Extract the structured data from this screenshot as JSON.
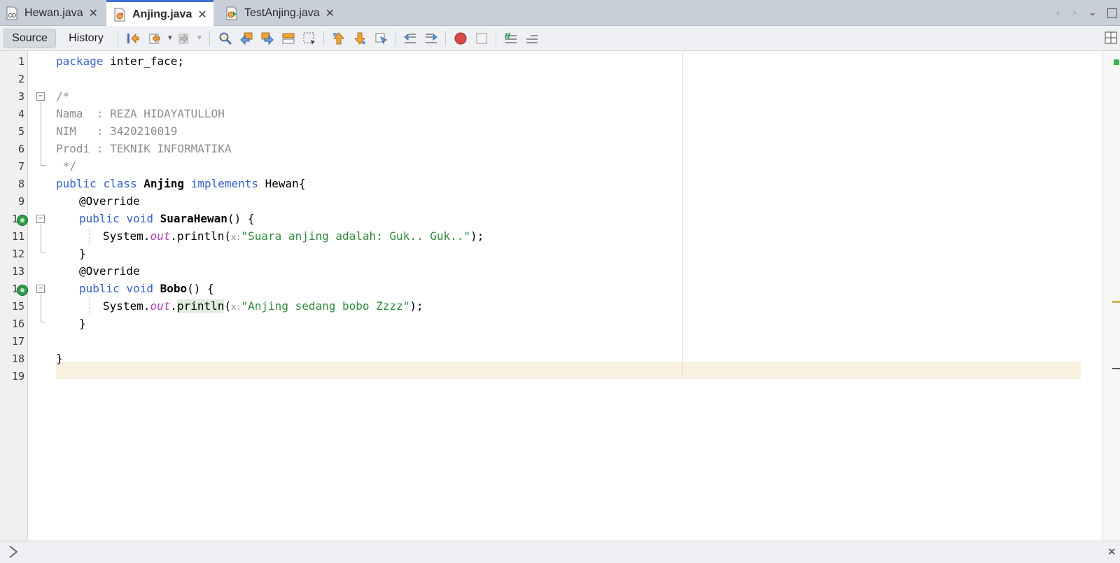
{
  "tabs": [
    {
      "label": "Hewan.java",
      "close": "✕",
      "active": false
    },
    {
      "label": "Anjing.java",
      "close": "✕",
      "active": true
    },
    {
      "label": "TestAnjing.java",
      "close": "✕",
      "active": false
    }
  ],
  "toolbar": {
    "source_label": "Source",
    "history_label": "History"
  },
  "editor": {
    "line_numbers": [
      "1",
      "2",
      "3",
      "4",
      "5",
      "6",
      "7",
      "8",
      "9",
      "10",
      "11",
      "12",
      "13",
      "14",
      "15",
      "16",
      "17",
      "18",
      "19"
    ],
    "package_kw": "package",
    "package_name": " inter_face;",
    "comment_open": "/*",
    "comment_nama": "Nama  : REZA HIDAYATULLOH",
    "comment_nim": "NIM   : 3420210019",
    "comment_prodi": "Prodi : TEKNIK INFORMATIKA",
    "comment_close": " */",
    "class_public": "public",
    "class_kw": "class",
    "class_name": "Anjing",
    "implements_kw": "implements",
    "interface_name": " Hewan{",
    "override1": "@Override",
    "m1_public": "public",
    "m1_void": "void",
    "m1_name": "SuaraHewan",
    "m1_rest": "() {",
    "p1_system": "System.",
    "p1_out": "out",
    "p1_println": ".println(",
    "p1_hint": "x:",
    "p1_string": "\"Suara anjing adalah: Guk.. Guk..\"",
    "p1_end": ");",
    "close1": "}",
    "override2": "@Override",
    "m2_public": "public",
    "m2_void": "void",
    "m2_name": "Bobo",
    "m2_rest": "() {",
    "p2_system": "System.",
    "p2_out": "out",
    "p2_dot": ".",
    "p2_println": "println",
    "p2_paren": "(",
    "p2_hint": "x:",
    "p2_string": "\"Anjing sedang bobo Zzzz\"",
    "p2_end": ");",
    "close2": "}",
    "class_close": "}"
  },
  "fold_glyph": "−",
  "colors": {
    "keyword": "#3560c9",
    "comment": "#8e8e8e",
    "string": "#2f8a3c",
    "field": "#b33bb5",
    "active_tab_accent": "#3b6fd4",
    "current_line": "#f8f1e0"
  }
}
